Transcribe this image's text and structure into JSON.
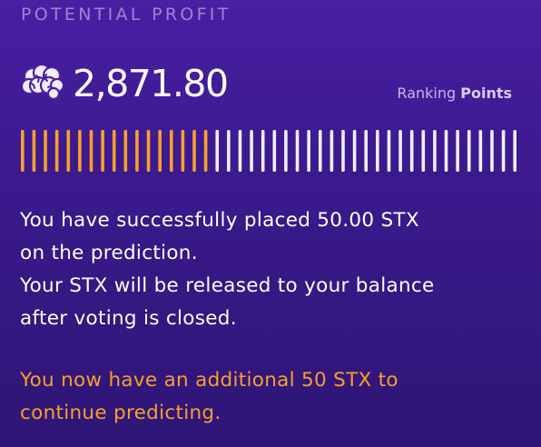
{
  "header": {
    "label": "POTENTIAL PROFIT"
  },
  "points": {
    "icon": "brain-icon",
    "value": "2,871.80",
    "ranking_prefix": "Ranking",
    "ranking_strong": "Points"
  },
  "meter": {
    "filled": 17,
    "total": 44,
    "colors": {
      "filled": "#f7a02e",
      "empty": "#f1eefb"
    }
  },
  "confirmation": {
    "line1": "You have successfully placed 50.00 STX",
    "line2": "on the prediction.",
    "line3": "Your STX will be released to your balance",
    "line4": "after voting is closed."
  },
  "bonus": {
    "line1": "You now have an additional 50 STX to",
    "line2": "continue predicting."
  },
  "colors": {
    "accent": "#f7a02e",
    "background_top": "#4a1fa3",
    "background_bottom": "#2e1575"
  }
}
